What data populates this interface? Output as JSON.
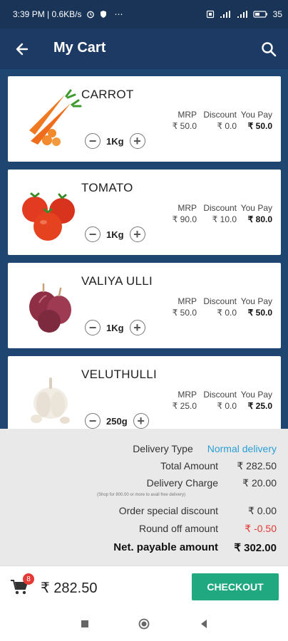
{
  "status": {
    "time_text": "3:39 PM | 0.6KB/s",
    "more": "⋯",
    "battery": "35"
  },
  "header": {
    "title": "My Cart"
  },
  "columns": {
    "mrp": "MRP",
    "discount": "Discount",
    "you_pay": "You Pay"
  },
  "products": [
    {
      "name": "CARROT",
      "mrp": "₹ 50.0",
      "discount": "₹ 0.0",
      "you_pay": "₹ 50.0",
      "qty": "1Kg"
    },
    {
      "name": "TOMATO",
      "mrp": "₹ 90.0",
      "discount": "₹ 10.0",
      "you_pay": "₹ 80.0",
      "qty": "1Kg"
    },
    {
      "name": "VALIYA ULLI",
      "mrp": "₹ 50.0",
      "discount": "₹ 0.0",
      "you_pay": "₹ 50.0",
      "qty": "1Kg"
    },
    {
      "name": "VELUTHULLI",
      "mrp": "₹ 25.0",
      "discount": "₹ 0.0",
      "you_pay": "₹ 25.0",
      "qty": "250g"
    }
  ],
  "summary": {
    "delivery_type_label": "Delivery Type",
    "delivery_type_value": "Normal delivery",
    "total_amount_label": "Total Amount",
    "total_amount_value": "₹ 282.50",
    "delivery_charge_label": "Delivery Charge",
    "delivery_charge_value": "₹ 20.00",
    "delivery_note": "(Shop for 800.00 or more to avail free delivery)",
    "special_discount_label": "Order special discount",
    "special_discount_value": "₹ 0.00",
    "round_off_label": "Round off amount",
    "round_off_value": "₹ -0.50",
    "net_payable_label": "Net. payable amount",
    "net_payable_value": "₹ 302.00"
  },
  "bottom": {
    "cart_count": "8",
    "total": "₹ 282.50",
    "checkout_label": "CHECKOUT"
  },
  "colors": {
    "app_bar": "#1c3a63",
    "checkout": "#20a980",
    "delivery_link": "#2a9fd6",
    "negative": "#e53935"
  }
}
